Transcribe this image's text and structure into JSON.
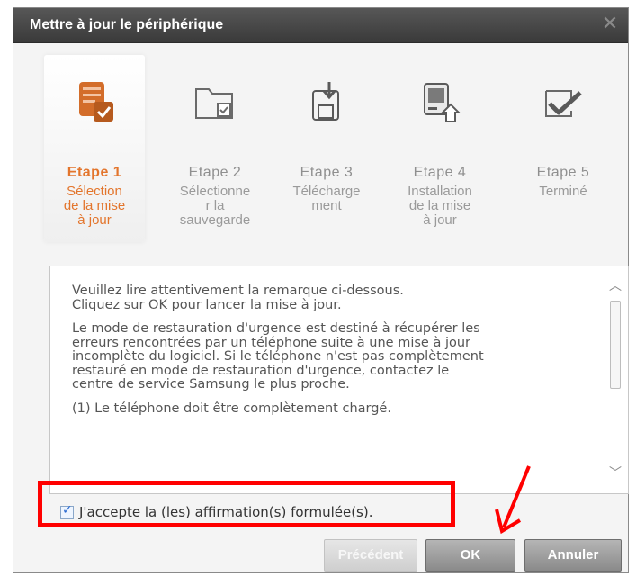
{
  "window": {
    "title": "Mettre à jour le périphérique",
    "close_glyph": "✕"
  },
  "steps": [
    {
      "name": "Etape 1",
      "desc": "Sélection\nde la mise\nà jour",
      "icon": "update-selection-icon",
      "active": true
    },
    {
      "name": "Etape 2",
      "desc": "Sélectionne\nr la\nsauvegarde",
      "icon": "folder-backup-icon",
      "active": false
    },
    {
      "name": "Etape 3",
      "desc": "Télécharge\nment",
      "icon": "download-icon",
      "active": false
    },
    {
      "name": "Etape 4",
      "desc": "Installation\nde la mise\nà jour",
      "icon": "install-icon",
      "active": false
    },
    {
      "name": "Etape 5",
      "desc": "Terminé",
      "icon": "complete-check-icon",
      "active": false
    }
  ],
  "notice": {
    "paragraphs": [
      "Veuillez lire attentivement la remarque ci-dessous.\nCliquez sur OK pour lancer la mise à jour.",
      "Le mode de restauration d'urgence est destiné à récupérer les\nerreurs rencontrées par un  téléphone suite à une mise à jour\nincomplète du logiciel. Si le téléphone n'est pas complètement\nrestauré en mode de restauration d'urgence, contactez le\ncentre de service Samsung le plus proche.",
      "(1) Le téléphone doit être complètement chargé."
    ]
  },
  "agreement": {
    "label": "J'accepte la (les) affirmation(s) formulée(s).",
    "checked": true
  },
  "buttons": {
    "previous": "Précédent",
    "ok": "OK",
    "cancel": "Annuler"
  },
  "colors": {
    "accent": "#e3752c",
    "highlight": "#ff0000",
    "titlebar": "#454545"
  }
}
